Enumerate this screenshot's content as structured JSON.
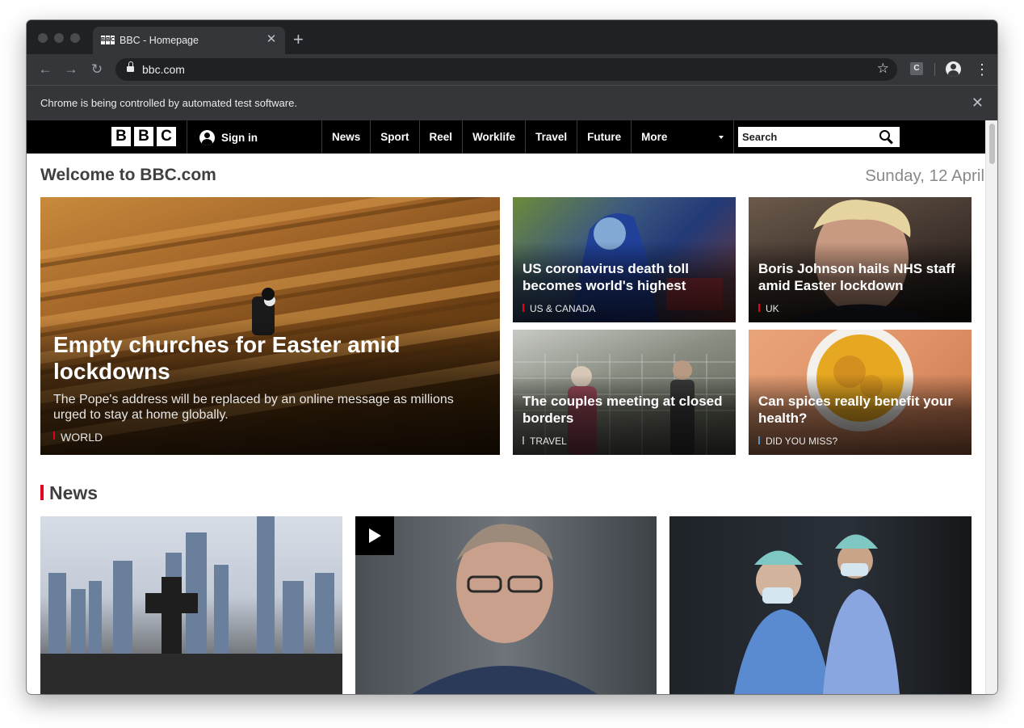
{
  "browser": {
    "tab": {
      "title": "BBC - Homepage",
      "favicon": [
        "B",
        "B",
        "C"
      ]
    },
    "url": "bbc.com",
    "infobar_text": "Chrome is being controlled by automated test software.",
    "extension_label": "C"
  },
  "bbc": {
    "logo": [
      "B",
      "B",
      "C"
    ],
    "signin_label": "Sign in",
    "nav": [
      "News",
      "Sport",
      "Reel",
      "Worklife",
      "Travel",
      "Future",
      "More"
    ],
    "search_placeholder": "Search"
  },
  "page": {
    "welcome": "Welcome to BBC.com",
    "date": "Sunday, 12 April"
  },
  "hero": {
    "title": "Empty churches for Easter amid lockdowns",
    "summary": "The Pope's address will be replaced by an online message as millions urged to stay at home globally.",
    "tag": "WORLD"
  },
  "stories": [
    {
      "title": "US coronavirus death toll becomes world's highest",
      "tag": "US & CANADA"
    },
    {
      "title": "Boris Johnson hails NHS staff amid Easter lockdown",
      "tag": "UK"
    },
    {
      "title": "The couples meeting at closed borders",
      "tag": "TRAVEL"
    },
    {
      "title": "Can spices really benefit your health?",
      "tag": "DID YOU MISS?"
    }
  ],
  "news_section": {
    "heading": "News"
  },
  "colors": {
    "bbc_red": "#e6001d",
    "nav_black": "#000000",
    "chrome_dark": "#35363a"
  }
}
